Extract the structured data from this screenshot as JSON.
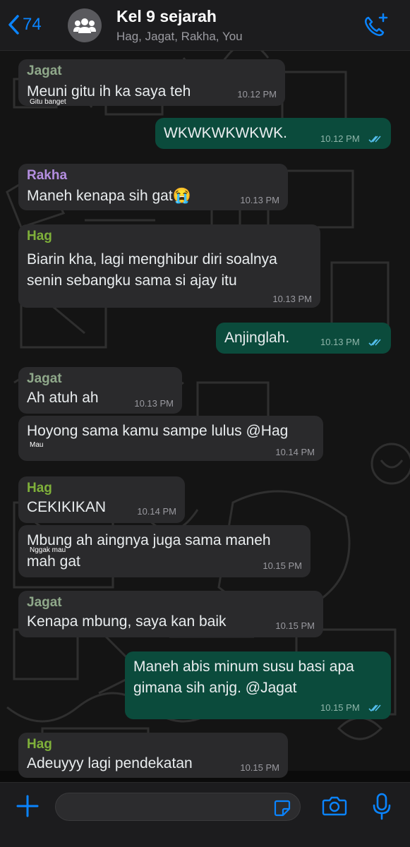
{
  "header": {
    "back_count": "74",
    "title": "Kel 9 sejarah",
    "subtitle": "Hag, Jagat, Rakha, You"
  },
  "messages": [
    {
      "sender": "Jagat",
      "text": "Meuni gitu ih ka saya teh",
      "note": "Gitu banget",
      "time": "10.12 PM"
    },
    {
      "text": "WKWKWKWKWK.",
      "time": "10.12 PM"
    },
    {
      "sender": "Rakha",
      "text": "Maneh kenapa sih gat😭",
      "time": "10.13 PM"
    },
    {
      "sender": "Hag",
      "line1": "Biarin kha, lagi menghibur diri soalnya",
      "line2": "senin sebangku sama si ajay itu",
      "time": "10.13 PM"
    },
    {
      "text": "Anjinglah.",
      "time": "10.13 PM"
    },
    {
      "sender": "Jagat",
      "text": "Ah atuh ah",
      "time": "10.13 PM"
    },
    {
      "text": "Hoyong sama kamu sampe lulus @Hag",
      "note": "Mau",
      "time": "10.14 PM"
    },
    {
      "sender": "Hag",
      "text": "CEKIKIKAN",
      "time": "10.14 PM"
    },
    {
      "line1": "Mbung ah aingnya juga sama maneh",
      "line2": "mah gat",
      "note": "Nggak mau",
      "time": "10.15 PM"
    },
    {
      "sender": "Jagat",
      "text": "Kenapa mbung, saya kan baik",
      "time": "10.15 PM"
    },
    {
      "line1": "Maneh abis minum susu basi apa",
      "line2": "gimana sih anjg. @Jagat",
      "time": "10.15 PM"
    },
    {
      "sender": "Hag",
      "text": "Adeuyyy lagi pendekatan",
      "time": "10.15 PM"
    }
  ],
  "colors": {
    "jagat": "#8fa88a",
    "rakha": "#b48ee0",
    "hag": "#7fb03a",
    "accent": "#0a84ff",
    "outgoing_bubble": "#0b4b3c",
    "incoming_bubble": "#2a2a2c",
    "read_ticks": "#53bdeb"
  },
  "icons": {
    "back": "chevron-left-icon",
    "group": "group-avatar-icon",
    "call": "add-call-icon",
    "plus": "plus-icon",
    "sticker": "sticker-icon",
    "camera": "camera-icon",
    "mic": "microphone-icon"
  }
}
